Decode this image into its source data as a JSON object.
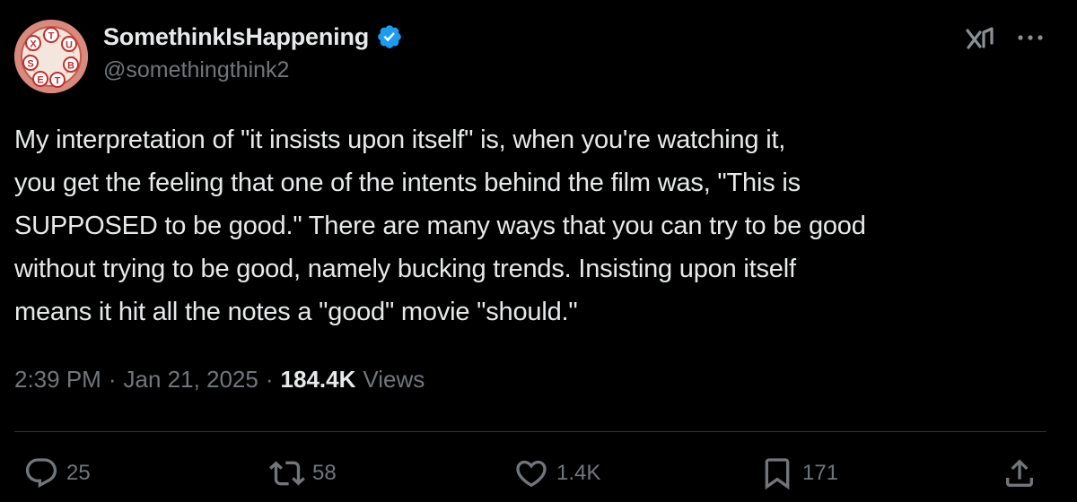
{
  "author": {
    "display_name": "SomethinkIsHappening",
    "handle": "@somethingthink2",
    "verified": true,
    "avatar_letters": [
      "T",
      "U",
      "B",
      "T",
      "E",
      "S",
      "X"
    ]
  },
  "tweet": {
    "text": "My interpretation of \"it insists upon itself\" is, when you're watching it,\nyou get the feeling that one of the intents behind the film was, \"This is\nSUPPOSED to be good.\" There are many ways that you can try to be good\nwithout trying to be good, namely bucking trends. Insisting upon itself\nmeans it hit all the notes a \"good\" movie \"should.\""
  },
  "meta": {
    "time": "2:39 PM",
    "separator": "·",
    "date": "Jan 21, 2025",
    "views_count": "184.4K",
    "views_label": "Views"
  },
  "actions": {
    "reply_count": "25",
    "repost_count": "58",
    "like_count": "1.4K",
    "bookmark_count": "171"
  },
  "colors": {
    "background": "#000000",
    "text_primary": "#e7e9ea",
    "text_secondary": "#71767b",
    "verified": "#1d9bf0",
    "divider": "#2f3336"
  },
  "icons": {
    "verified": "verified-badge-icon",
    "grok": "grok-icon",
    "more": "more-dots-icon",
    "reply": "reply-icon",
    "repost": "repost-icon",
    "like": "heart-icon",
    "bookmark": "bookmark-icon",
    "share": "share-icon"
  }
}
